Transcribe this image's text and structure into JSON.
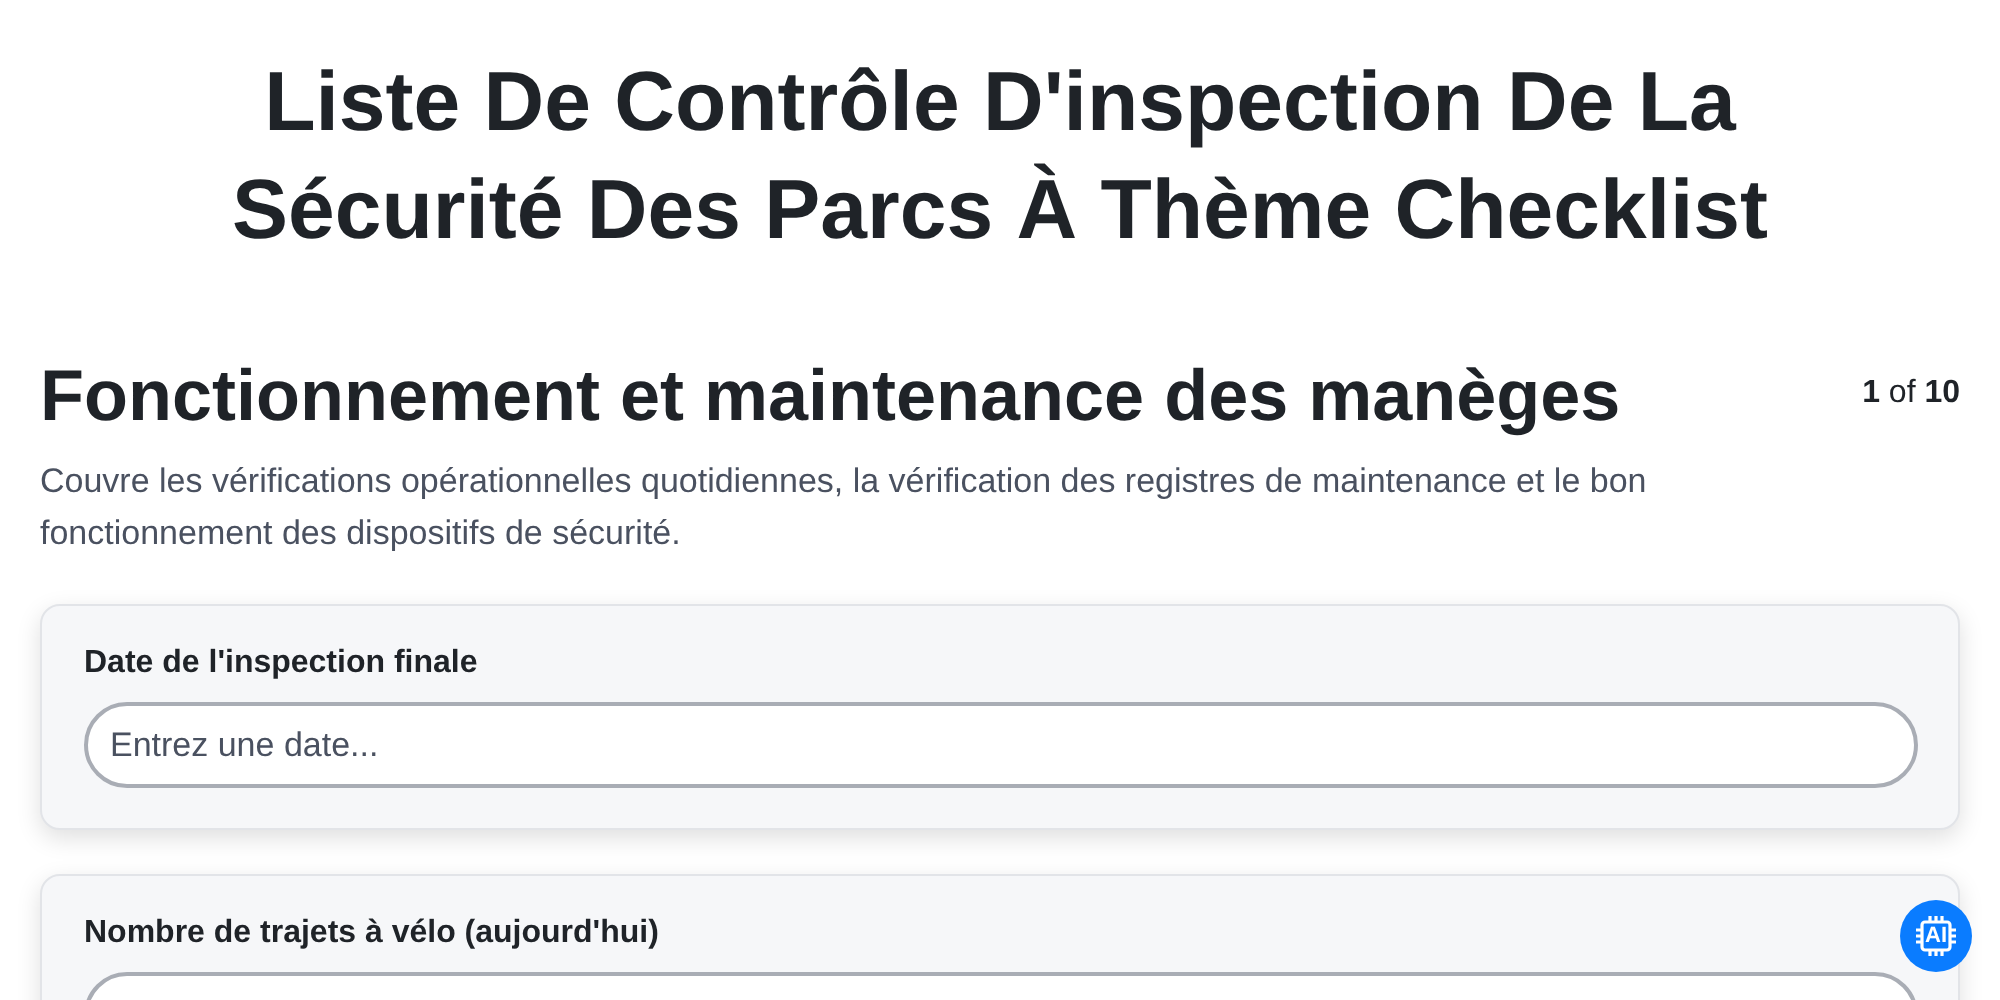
{
  "title": "Liste De Contrôle D'inspection De La Sécurité Des Parcs À Thème Checklist",
  "section": {
    "heading": "Fonctionnement et maintenance des manèges",
    "page_counter": "**1** of **10**",
    "description": "Couvre les vérifications opérationnelles quotidiennes, la vérification des registres de maintenance et le bon fonctionnement des dispositifs de sécurité."
  },
  "questions": [
    {
      "label": "Date de l'inspection finale",
      "placeholder": "Entrez une date..."
    },
    {
      "label": "Nombre de trajets à vélo (aujourd'hui)"
    }
  ],
  "ai_button": {
    "label": "AI"
  }
}
